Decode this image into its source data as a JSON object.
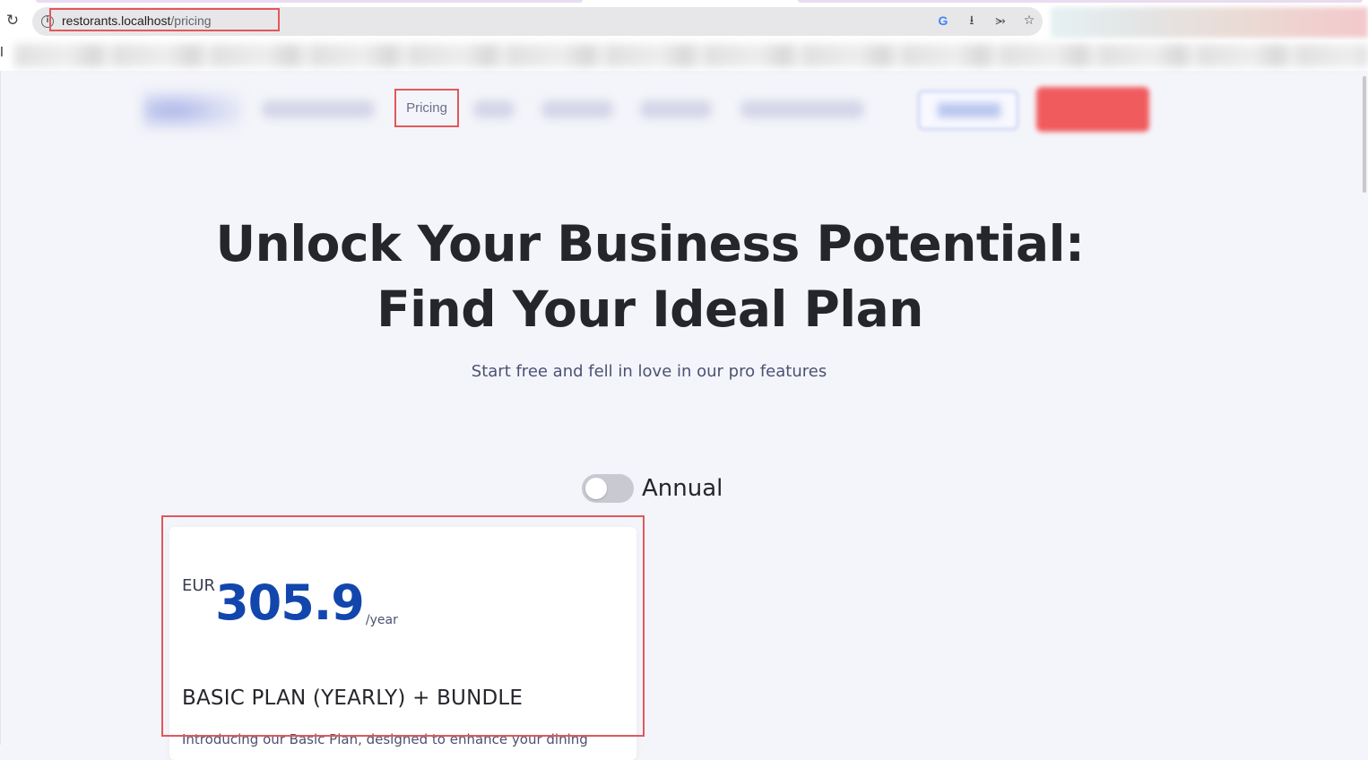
{
  "browser": {
    "url_host": "restorants.localhost",
    "url_path": "/pricing",
    "reload_icon": "reload-icon",
    "info_icon": "info-icon",
    "omnibox_icons": [
      "google-icon",
      "install-icon",
      "share-icon",
      "star-icon"
    ],
    "bookmark_char": "l"
  },
  "nav": {
    "pricing_label": "Pricing"
  },
  "hero": {
    "title_line1": "Unlock Your Business Potential:",
    "title_line2": "Find Your Ideal Plan",
    "subtitle": "Start free and fell in love in our pro features"
  },
  "billing_toggle": {
    "label": "Annual",
    "enabled": false
  },
  "plan_card": {
    "currency": "EUR",
    "amount": "305.9",
    "period": "/year",
    "name": "BASIC PLAN (YEARLY) + BUNDLE",
    "description": "Introducing our Basic Plan, designed to enhance your dining"
  },
  "colors": {
    "accent_blue": "#1346ad",
    "highlight_red": "#e0585c",
    "signup_red": "#f05b5e"
  }
}
